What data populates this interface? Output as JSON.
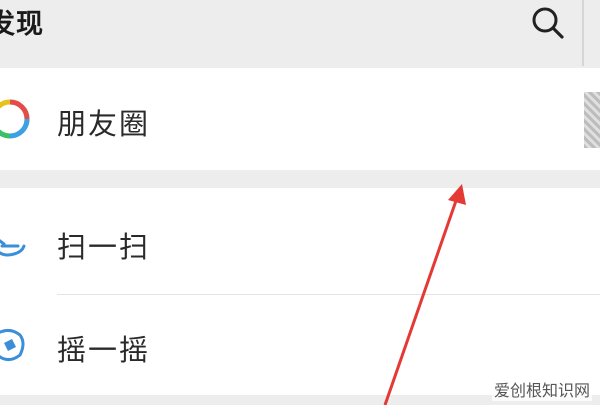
{
  "header": {
    "title": "发现",
    "search_icon": "search-icon"
  },
  "menu": {
    "moments": {
      "label": "朋友圈",
      "icon": "moments-icon"
    },
    "scan": {
      "label": "扫一扫",
      "icon": "scan-icon"
    },
    "shake": {
      "label": "摇一摇",
      "icon": "shake-icon"
    }
  },
  "overlay": {
    "arrow_color": "#e53935",
    "watermark": "爱创根知识网"
  },
  "colors": {
    "background": "#ededed",
    "cell": "#ffffff"
  }
}
